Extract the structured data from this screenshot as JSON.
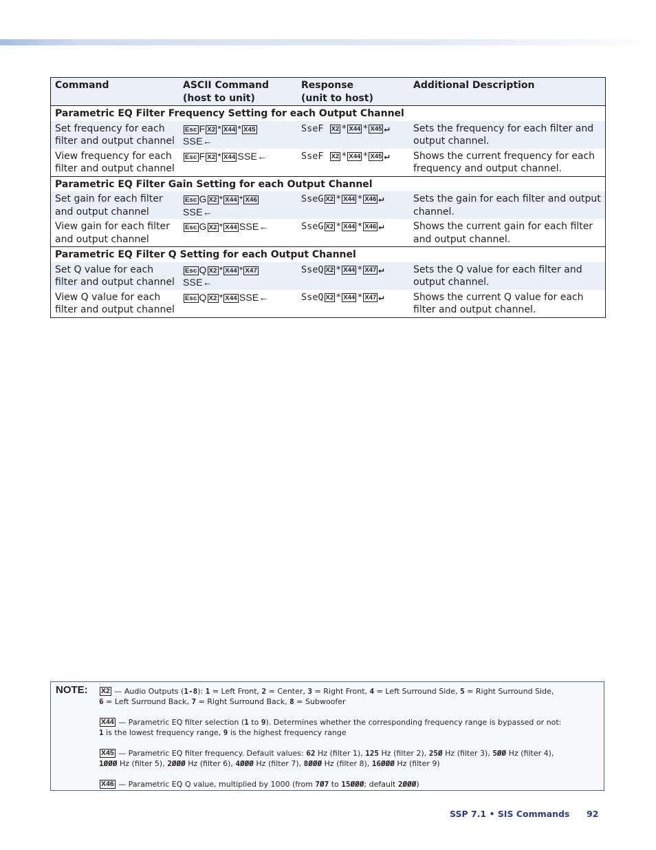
{
  "header_band": {
    "color_start": "#a3bde3",
    "color_end": "#ffffff"
  },
  "table": {
    "columns": [
      "Command",
      "ASCII Command\n(host to unit)",
      "Response\n(unit to host)",
      "Additional Description"
    ],
    "col1": "Command",
    "col2_line1": "ASCII Command",
    "col2_line2": "(host to unit)",
    "col3_line1": "Response",
    "col3_line2": "(unit to host)",
    "col4": "Additional Description",
    "sections": [
      {
        "title": "Parametric EQ Filter Frequency Setting for each Output Channel",
        "rows": [
          {
            "command": "Set frequency for each filter and output channel",
            "ascii": {
              "esc": "Esc",
              "letter": "F",
              "x1": "X2",
              "x2": "X44",
              "x3": "X45",
              "suffix": "SSE",
              "end": "←"
            },
            "response": {
              "prefix": "SseF ",
              "x1": "X2",
              "x2": "X44",
              "x3": "X45",
              "end": "↵"
            },
            "description": "Sets the frequency for each filter and output channel."
          },
          {
            "command": "View frequency for each filter and output channel",
            "ascii": {
              "esc": "Esc",
              "letter": "F",
              "x1": "X2",
              "x2": "X44",
              "suffix": "SSE",
              "end": "←"
            },
            "response": {
              "prefix": "SseF ",
              "x1": "X2",
              "x2": "X44",
              "x3": "X45",
              "end": "↵"
            },
            "description": "Shows the current frequency for each frequency and output channel."
          }
        ]
      },
      {
        "title": "Parametric EQ Filter Gain Setting for each Output Channel",
        "rows": [
          {
            "command": "Set gain for each filter and output channel",
            "ascii": {
              "esc": "Esc",
              "letter": "G",
              "x1": "X2",
              "x2": "X44",
              "x3": "X46",
              "suffix": "SSE",
              "end": "←"
            },
            "response": {
              "prefix": "SseG",
              "x1": "X2",
              "x2": "X44",
              "x3": "X46",
              "end": "↵"
            },
            "description": "Sets the gain for each filter and output channel."
          },
          {
            "command": "View gain for each filter and output channel",
            "ascii": {
              "esc": "Esc",
              "letter": "G",
              "x1": "X2",
              "x2": "X44",
              "suffix": "SSE",
              "end": "←"
            },
            "response": {
              "prefix": "SseG",
              "x1": "X2",
              "x2": "X44",
              "x3": "X46",
              "end": "↵"
            },
            "description": "Shows the current gain for each filter and output channel."
          }
        ]
      },
      {
        "title": "Parametric EQ Filter Q Setting for each Output Channel",
        "rows": [
          {
            "command": "Set Q value for each filter and output channel",
            "ascii": {
              "esc": "Esc",
              "letter": "Q",
              "x1": "X2",
              "x2": "X44",
              "x3": "X47",
              "suffix": "SSE",
              "end": "←"
            },
            "response": {
              "prefix": "SseQ",
              "x1": "X2",
              "x2": "X44",
              "x3": "X47",
              "end": "↵"
            },
            "description": "Sets the Q value for each filter and output channel."
          },
          {
            "command": "View Q value for each filter and output channel",
            "ascii": {
              "esc": "Esc",
              "letter": "Q",
              "x1": "X2",
              "x2": "X44",
              "suffix": "SSE",
              "end": "←"
            },
            "response": {
              "prefix": "SseQ",
              "x1": "X2",
              "x2": "X44",
              "x3": "X47",
              "end": "↵"
            },
            "description": "Shows the current Q value for each filter and output channel."
          }
        ]
      }
    ]
  },
  "note": {
    "label": "NOTE:",
    "x2": {
      "key": "X2",
      "text1": " — Audio Outputs (",
      "range": "1-8",
      "text2": "): ",
      "items": [
        {
          "n": "1",
          "t": " = Left Front, "
        },
        {
          "n": "2",
          "t": " = Center, "
        },
        {
          "n": "3",
          "t": " = Right Front, "
        },
        {
          "n": "4",
          "t": " = Left Surround Side, "
        },
        {
          "n": "5",
          "t": " = Right Surround Side,"
        },
        {
          "n": "6",
          "t": " = Left Surround Back, "
        },
        {
          "n": "7",
          "t": " = Right Surround Back, "
        },
        {
          "n": "8",
          "t": " = Subwoofer"
        }
      ]
    },
    "x44": {
      "key": "X44",
      "text1": " — Parametric EQ filter selection (",
      "n1": "1",
      "to": " to ",
      "n2": "9",
      "text2": "). Determines whether the corresponding frequency range is bypassed or not:",
      "line2_n1": "1",
      "line2_t1": " is the lowest frequency range, ",
      "line2_n2": "9",
      "line2_t2": " is the highest frequency range"
    },
    "x45": {
      "key": "X45",
      "text1": " — Parametric EQ filter frequency. Default values: ",
      "defaults": [
        {
          "hz": "62",
          "filter": " Hz (filter 1), "
        },
        {
          "hz": "125",
          "filter": " Hz (filter 2), "
        },
        {
          "hz": "25Ø",
          "filter": " Hz (filter 3), "
        },
        {
          "hz": "5ØØ",
          "filter": " Hz (filter 4),"
        },
        {
          "hz": "1ØØØ",
          "filter": " Hz (filter 5), "
        },
        {
          "hz": "2ØØØ",
          "filter": " Hz (filter 6), "
        },
        {
          "hz": "4ØØØ",
          "filter": " Hz (filter 7), "
        },
        {
          "hz": "8ØØØ",
          "filter": " Hz (filter 8), "
        },
        {
          "hz": "16ØØØ",
          "filter": " Hz (filter 9)"
        }
      ]
    },
    "x46": {
      "key": "X46",
      "text1": " — Parametric EQ Q value, multiplied by 1000 (from ",
      "min": "7Ø7",
      "to": " to ",
      "max": "15ØØØ",
      "text2": "; default ",
      "def": "2ØØØ",
      "text3": ")"
    }
  },
  "footer": {
    "title": "SSP 7.1 • SIS Commands",
    "page": "92"
  }
}
